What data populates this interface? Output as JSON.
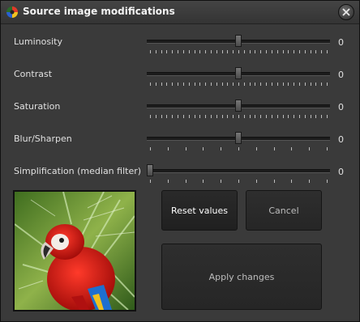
{
  "window": {
    "title": "Source image modifications"
  },
  "sliders": [
    {
      "label": "Luminosity",
      "value": "0",
      "position": 0.5,
      "ticks": 33
    },
    {
      "label": "Contrast",
      "value": "0",
      "position": 0.5,
      "ticks": 33
    },
    {
      "label": "Saturation",
      "value": "0",
      "position": 0.5,
      "ticks": 33
    },
    {
      "label": "Blur/Sharpen",
      "value": "0",
      "position": 0.5,
      "ticks": 11
    },
    {
      "label": "Simplification (median filter)",
      "value": "0",
      "position": 0.0,
      "ticks": 11
    }
  ],
  "buttons": {
    "reset": "Reset values",
    "cancel": "Cancel",
    "apply": "Apply changes"
  },
  "preview": {
    "subject": "parrot"
  }
}
